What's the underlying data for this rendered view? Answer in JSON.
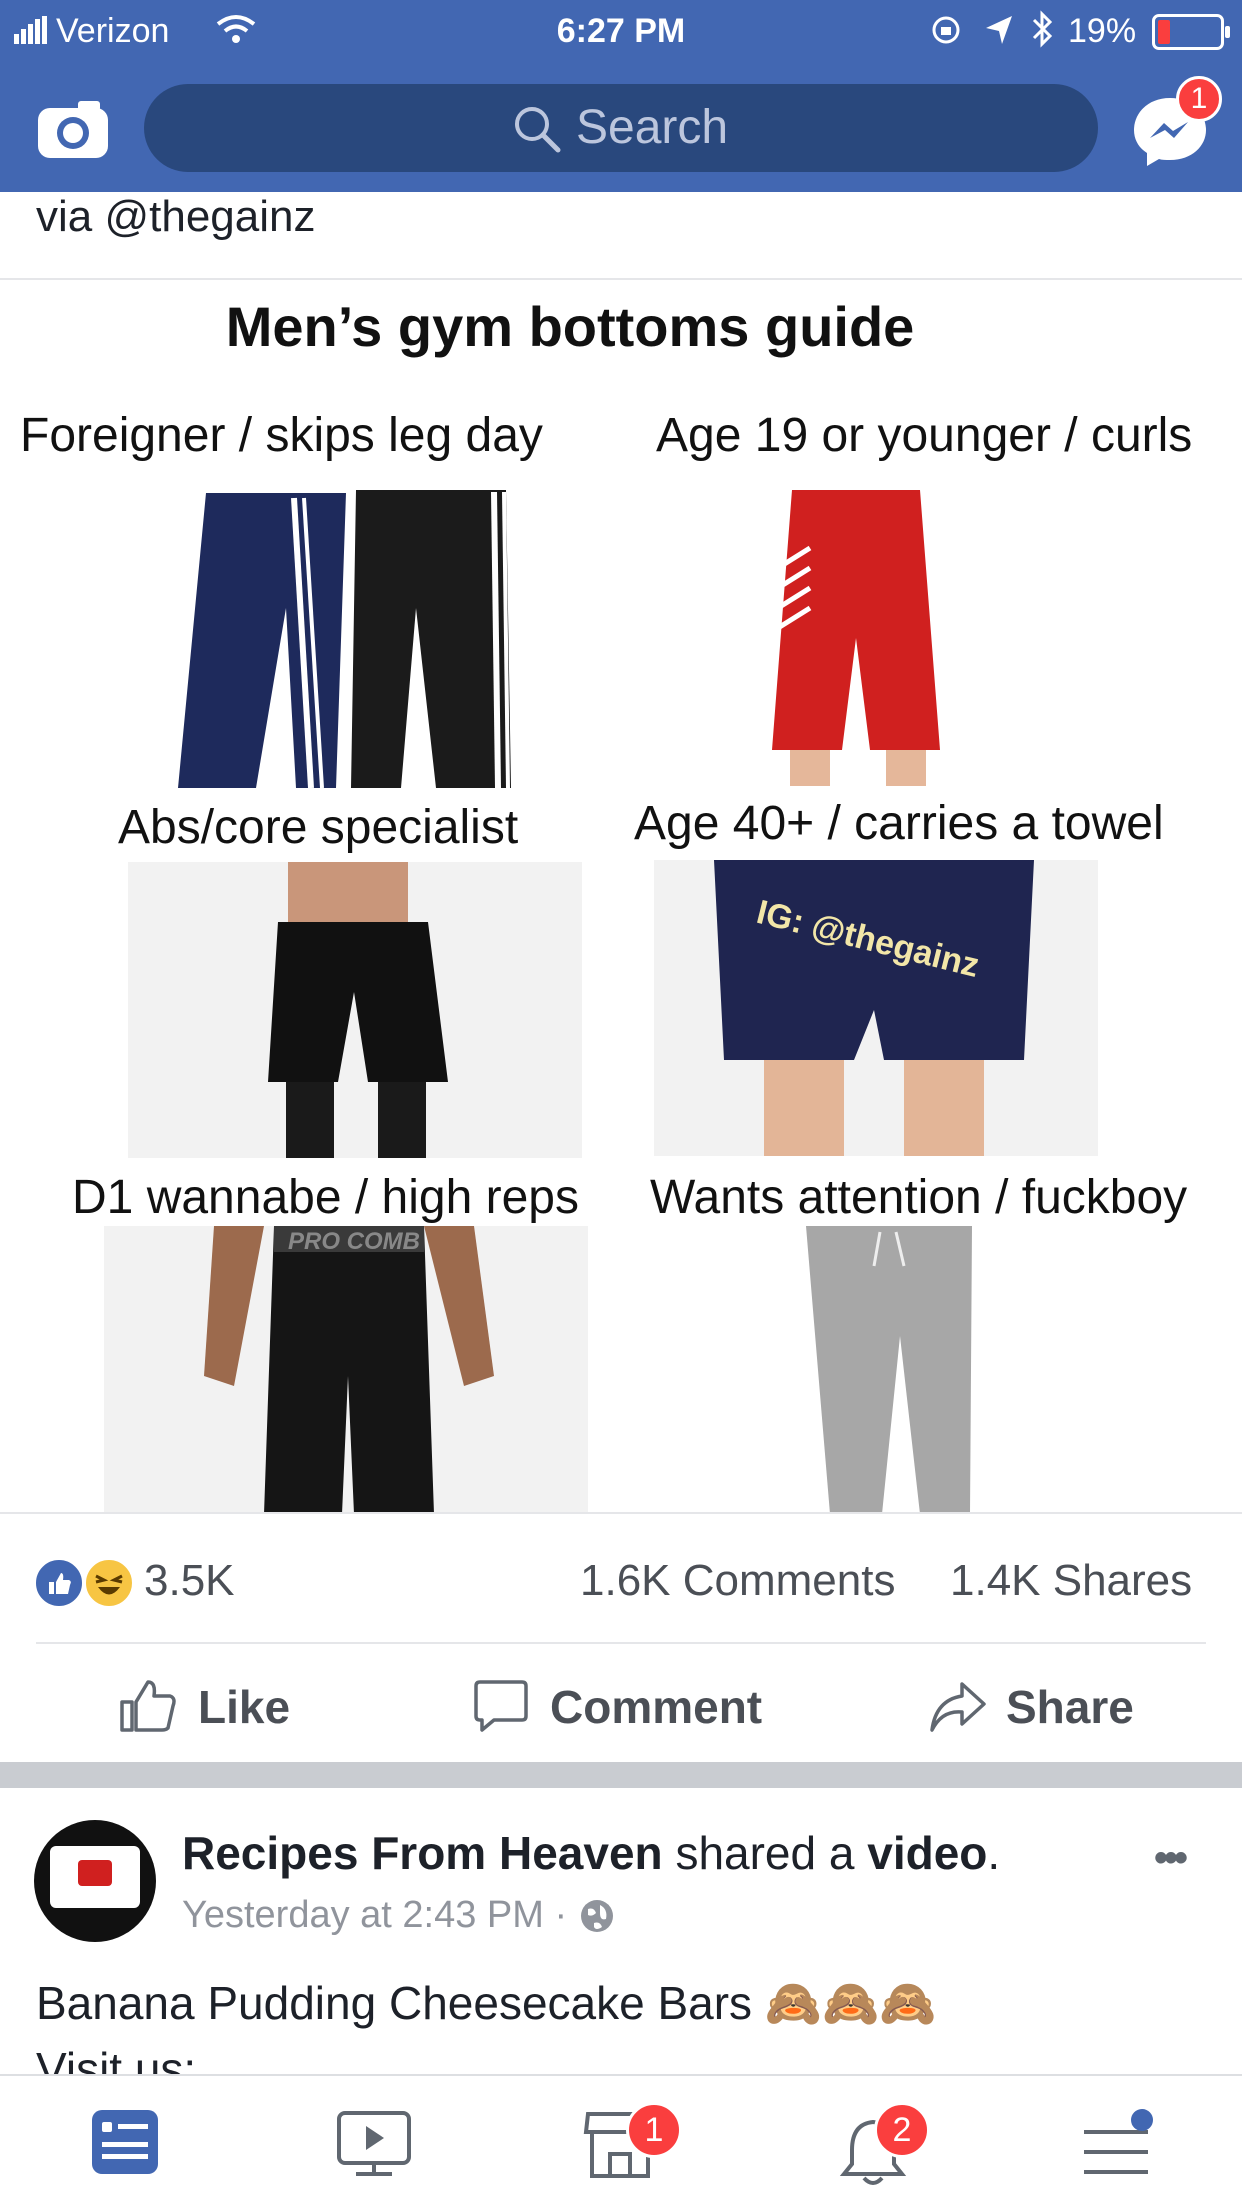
{
  "status": {
    "carrier": "Verizon",
    "time": "6:27 PM",
    "battery": "19%"
  },
  "nav": {
    "search_placeholder": "Search",
    "messenger_badge": "1"
  },
  "post": {
    "via": "via @thegainz",
    "meme": {
      "title": "Men’s gym bottoms guide",
      "cells": [
        {
          "caption": "Foreigner / skips leg day"
        },
        {
          "caption": "Age 19 or younger / curls"
        },
        {
          "caption": "Abs/core specialist"
        },
        {
          "caption": "Age 40+ / carries a  towel"
        },
        {
          "caption": "D1 wannabe / high reps"
        },
        {
          "caption": "Wants attention / fuckboy"
        }
      ],
      "watermark": "IG: @thegainz",
      "waistband_text": "PRO COMB"
    },
    "reactions_count": "3.5K",
    "comments": "1.6K Comments",
    "shares": "1.4K Shares",
    "actions": {
      "like": "Like",
      "comment": "Comment",
      "share": "Share"
    }
  },
  "next_post": {
    "author": "Recipes From Heaven",
    "shared_a": "shared a",
    "object": "video",
    "period": ".",
    "time": "Yesterday at 2:43 PM ·",
    "text": "Banana Pudding Cheesecake Bars 🙈🙈🙈",
    "text2": "Visit us:",
    "more": "•••"
  },
  "tabbar": {
    "marketplace_badge": "1",
    "notifications_badge": "2"
  },
  "colors": {
    "brand": "#4267b2",
    "search_bg": "#29487d",
    "badge": "#fa3e3e",
    "like_blue": "#4267b2"
  }
}
